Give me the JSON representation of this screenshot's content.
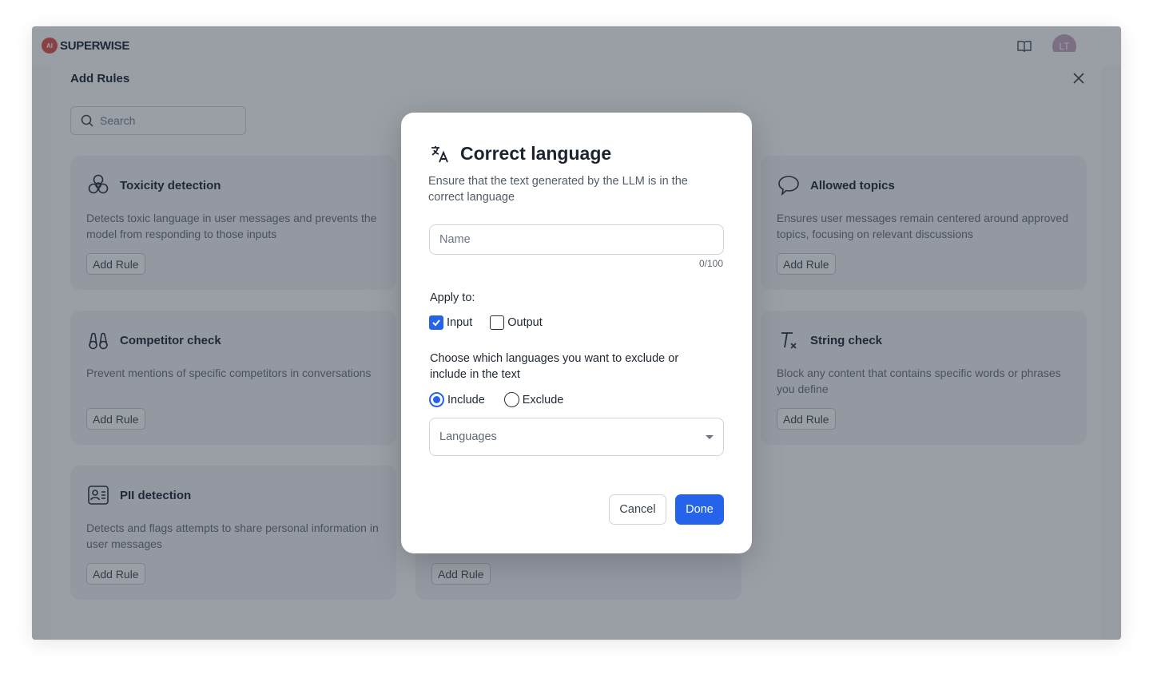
{
  "app": {
    "logo_mark": "AI",
    "logo_text": "SUPERWISE",
    "avatar_initials": "LT"
  },
  "panel": {
    "title": "Add Rules",
    "search_placeholder": "Search",
    "cards": [
      {
        "title": "Toxicity detection",
        "description": "Detects toxic language in user messages and prevents the model from responding to those inputs",
        "button": "Add Rule",
        "icon": "biohazard-icon"
      },
      {
        "title": "Allowed topics",
        "description": "Ensures user messages remain centered around approved topics, focusing on relevant discussions",
        "button": "Add Rule",
        "icon": "speech-bubble-icon"
      },
      {
        "title": "Competitor check",
        "description": "Prevent mentions of specific competitors in conversations",
        "button": "Add Rule",
        "icon": "binoculars-icon"
      },
      {
        "title": "String check",
        "description": "Block any content that contains specific words or phrases you define",
        "button": "Add Rule",
        "icon": "clear-format-icon"
      },
      {
        "title": "PII detection",
        "description": "Detects and flags attempts to share personal information in user messages",
        "button": "Add Rule",
        "icon": "id-card-icon"
      },
      {
        "title": "",
        "description": "",
        "button": "Add Rule",
        "icon": ""
      }
    ]
  },
  "modal": {
    "title": "Correct language",
    "icon": "translate-icon",
    "subtitle": "Ensure that the text generated by the LLM is in the correct language",
    "name_placeholder": "Name",
    "name_value": "",
    "counter": "0/100",
    "apply_label": "Apply to:",
    "apply_options": [
      {
        "label": "Input",
        "checked": true
      },
      {
        "label": "Output",
        "checked": false
      }
    ],
    "choose_label": "Choose which languages you want to exclude or include in the text",
    "mode_options": [
      {
        "label": "Include",
        "selected": true
      },
      {
        "label": "Exclude",
        "selected": false
      }
    ],
    "languages_placeholder": "Languages",
    "cancel_label": "Cancel",
    "done_label": "Done"
  },
  "colors": {
    "primary": "#2563eb",
    "overlay": "rgba(30,40,56,0.45)"
  }
}
